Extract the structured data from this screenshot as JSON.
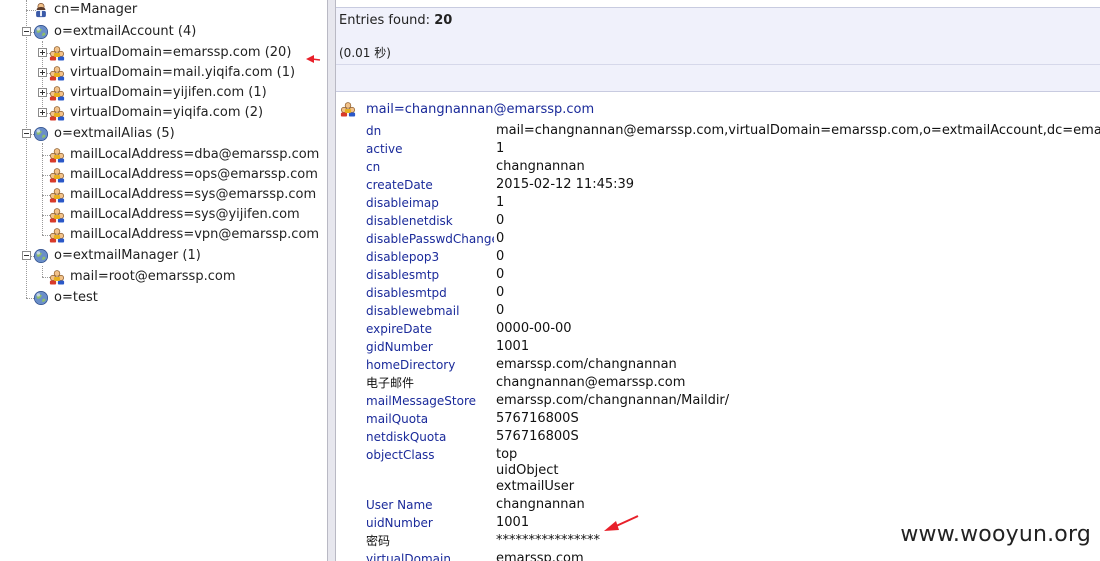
{
  "tree": {
    "nodes": [
      {
        "label": "cn=Manager",
        "icon": "user-icon",
        "expander": "none"
      },
      {
        "label": "o=extmailAccount (4)",
        "icon": "globe-icon",
        "expander": "minus"
      },
      {
        "label": "virtualDomain=emarssp.com (20)",
        "icon": "group-icon",
        "expander": "plus"
      },
      {
        "label": "virtualDomain=mail.yiqifa.com (1)",
        "icon": "group-icon",
        "expander": "plus"
      },
      {
        "label": "virtualDomain=yijifen.com (1)",
        "icon": "group-icon",
        "expander": "plus"
      },
      {
        "label": "virtualDomain=yiqifa.com (2)",
        "icon": "group-icon",
        "expander": "plus"
      },
      {
        "label": "o=extmailAlias (5)",
        "icon": "globe-icon",
        "expander": "minus"
      },
      {
        "label": "mailLocalAddress=dba@emarssp.com",
        "icon": "group-icon",
        "expander": "none"
      },
      {
        "label": "mailLocalAddress=ops@emarssp.com",
        "icon": "group-icon",
        "expander": "none"
      },
      {
        "label": "mailLocalAddress=sys@emarssp.com",
        "icon": "group-icon",
        "expander": "none"
      },
      {
        "label": "mailLocalAddress=sys@yijifen.com",
        "icon": "group-icon",
        "expander": "none"
      },
      {
        "label": "mailLocalAddress=vpn@emarssp.com",
        "icon": "group-icon",
        "expander": "none"
      },
      {
        "label": "o=extmailManager (1)",
        "icon": "globe-icon",
        "expander": "minus"
      },
      {
        "label": "mail=root@emarssp.com",
        "icon": "group-icon",
        "expander": "none"
      },
      {
        "label": "o=test",
        "icon": "globe-icon",
        "expander": "none"
      }
    ]
  },
  "summary": {
    "entries_label": "Entries found:",
    "entries_count": "20",
    "timing": "(0.01 秒)"
  },
  "entry": {
    "dn_title": "mail=changnannan@emarssp.com",
    "icon": "group-icon",
    "attributes": [
      {
        "name": "dn",
        "values": [
          "mail=changnannan@emarssp.com,virtualDomain=emarssp.com,o=extmailAccount,dc=emarssp.com"
        ]
      },
      {
        "name": "active",
        "values": [
          "1"
        ]
      },
      {
        "name": "cn",
        "values": [
          "changnannan"
        ]
      },
      {
        "name": "createDate",
        "values": [
          "2015-02-12 11:45:39"
        ]
      },
      {
        "name": "disableimap",
        "values": [
          "1"
        ]
      },
      {
        "name": "disablenetdisk",
        "values": [
          "0"
        ]
      },
      {
        "name": "disablePasswdChange",
        "values": [
          "0"
        ]
      },
      {
        "name": "disablepop3",
        "values": [
          "0"
        ]
      },
      {
        "name": "disablesmtp",
        "values": [
          "0"
        ]
      },
      {
        "name": "disablesmtpd",
        "values": [
          "0"
        ]
      },
      {
        "name": "disablewebmail",
        "values": [
          "0"
        ]
      },
      {
        "name": "expireDate",
        "values": [
          "0000-00-00"
        ]
      },
      {
        "name": "gidNumber",
        "values": [
          "1001"
        ]
      },
      {
        "name": "homeDirectory",
        "values": [
          "emarssp.com/changnannan"
        ]
      },
      {
        "name": "电子邮件",
        "values": [
          "changnannan@emarssp.com"
        ],
        "plain": true
      },
      {
        "name": "mailMessageStore",
        "values": [
          "emarssp.com/changnannan/Maildir/"
        ]
      },
      {
        "name": "mailQuota",
        "values": [
          "576716800S"
        ]
      },
      {
        "name": "netdiskQuota",
        "values": [
          "576716800S"
        ]
      },
      {
        "name": "objectClass",
        "values": [
          "top",
          "uidObject",
          "extmailUser"
        ]
      },
      {
        "name": "User Name",
        "values": [
          "changnannan"
        ]
      },
      {
        "name": "uidNumber",
        "values": [
          "1001"
        ]
      },
      {
        "name": "密码",
        "values": [
          "****************"
        ],
        "plain": true
      },
      {
        "name": "virtualDomain",
        "values": [
          "emarssp.com"
        ]
      }
    ]
  },
  "colors": {
    "link_blue": "#1a2a9a",
    "annotation_red": "#e8202a",
    "summary_bg": "#f0f1fb"
  },
  "watermark": "www.wooyun.org"
}
